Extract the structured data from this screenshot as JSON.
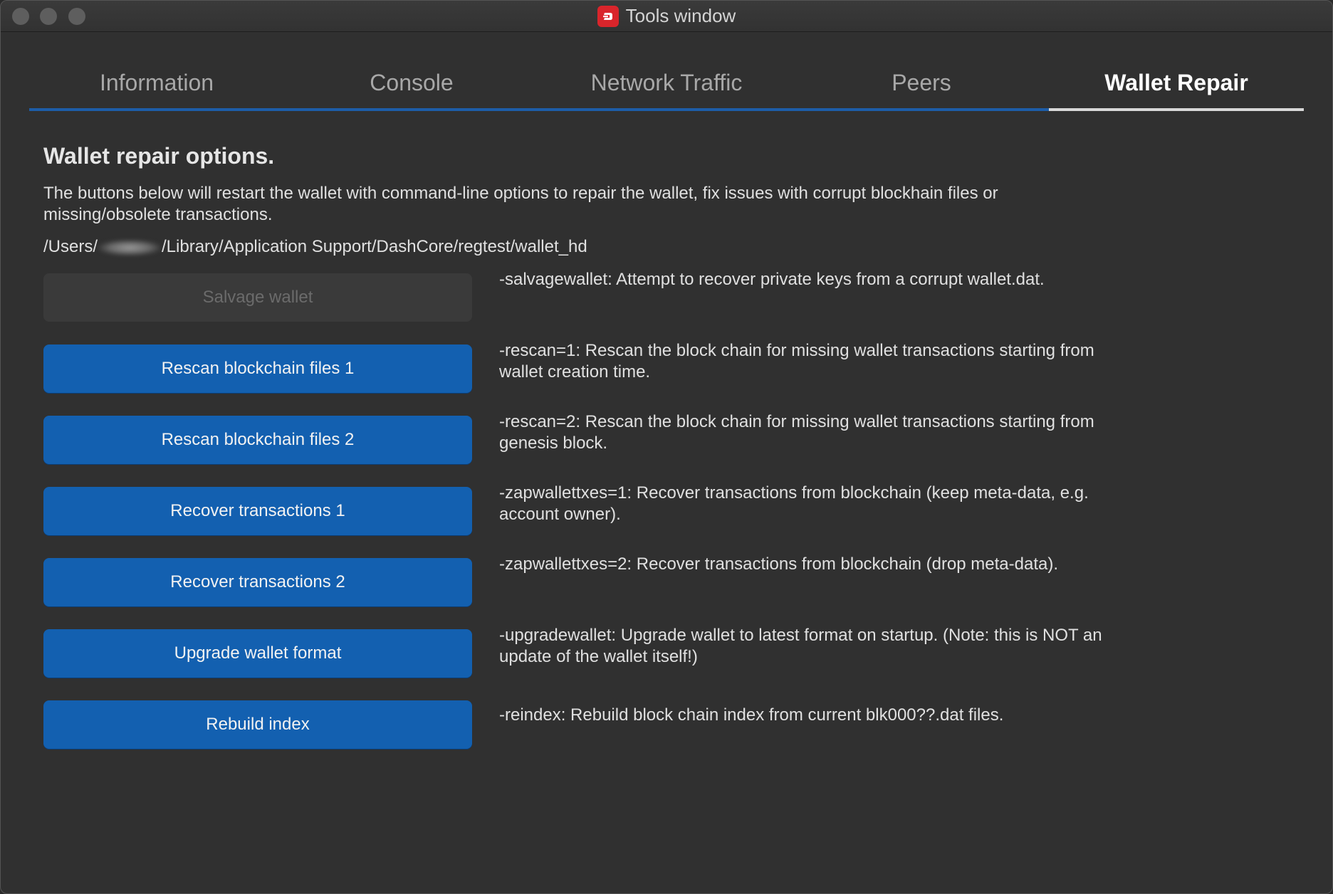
{
  "window": {
    "title": "Tools window",
    "traffic_lights": [
      "close",
      "minimize",
      "zoom"
    ]
  },
  "tabs": [
    {
      "label": "Information",
      "active": false
    },
    {
      "label": "Console",
      "active": false
    },
    {
      "label": "Network Traffic",
      "active": false
    },
    {
      "label": "Peers",
      "active": false
    },
    {
      "label": "Wallet Repair",
      "active": true
    }
  ],
  "repair": {
    "heading": "Wallet repair options.",
    "description": "The buttons below will restart the wallet with command-line options to repair the wallet, fix issues with corrupt blockhain files or missing/obsolete transactions.",
    "path_prefix": "/Users/",
    "path_suffix": "/Library/Application Support/DashCore/regtest/wallet_hd",
    "options": [
      {
        "button": "Salvage wallet",
        "enabled": false,
        "help": "-salvagewallet: Attempt to recover private keys from a corrupt wallet.dat."
      },
      {
        "button": "Rescan blockchain files 1",
        "enabled": true,
        "help": "-rescan=1: Rescan the block chain for missing wallet transactions starting from wallet creation time."
      },
      {
        "button": "Rescan blockchain files 2",
        "enabled": true,
        "help": "-rescan=2: Rescan the block chain for missing wallet transactions starting from genesis block."
      },
      {
        "button": "Recover transactions 1",
        "enabled": true,
        "help": "-zapwallettxes=1: Recover transactions from blockchain (keep meta-data, e.g. account owner)."
      },
      {
        "button": "Recover transactions 2",
        "enabled": true,
        "help": "-zapwallettxes=2: Recover transactions from blockchain (drop meta-data)."
      },
      {
        "button": "Upgrade wallet format",
        "enabled": true,
        "help": "-upgradewallet: Upgrade wallet to latest format on startup. (Note: this is NOT an update of the wallet itself!)"
      },
      {
        "button": "Rebuild index",
        "enabled": true,
        "help": "-reindex: Rebuild block chain index from current blk000??.dat files."
      }
    ]
  },
  "colors": {
    "accent": "#1360b0",
    "background": "#303030",
    "app_icon": "#d9252b"
  },
  "icons": {
    "app": "dash-logo-icon"
  }
}
